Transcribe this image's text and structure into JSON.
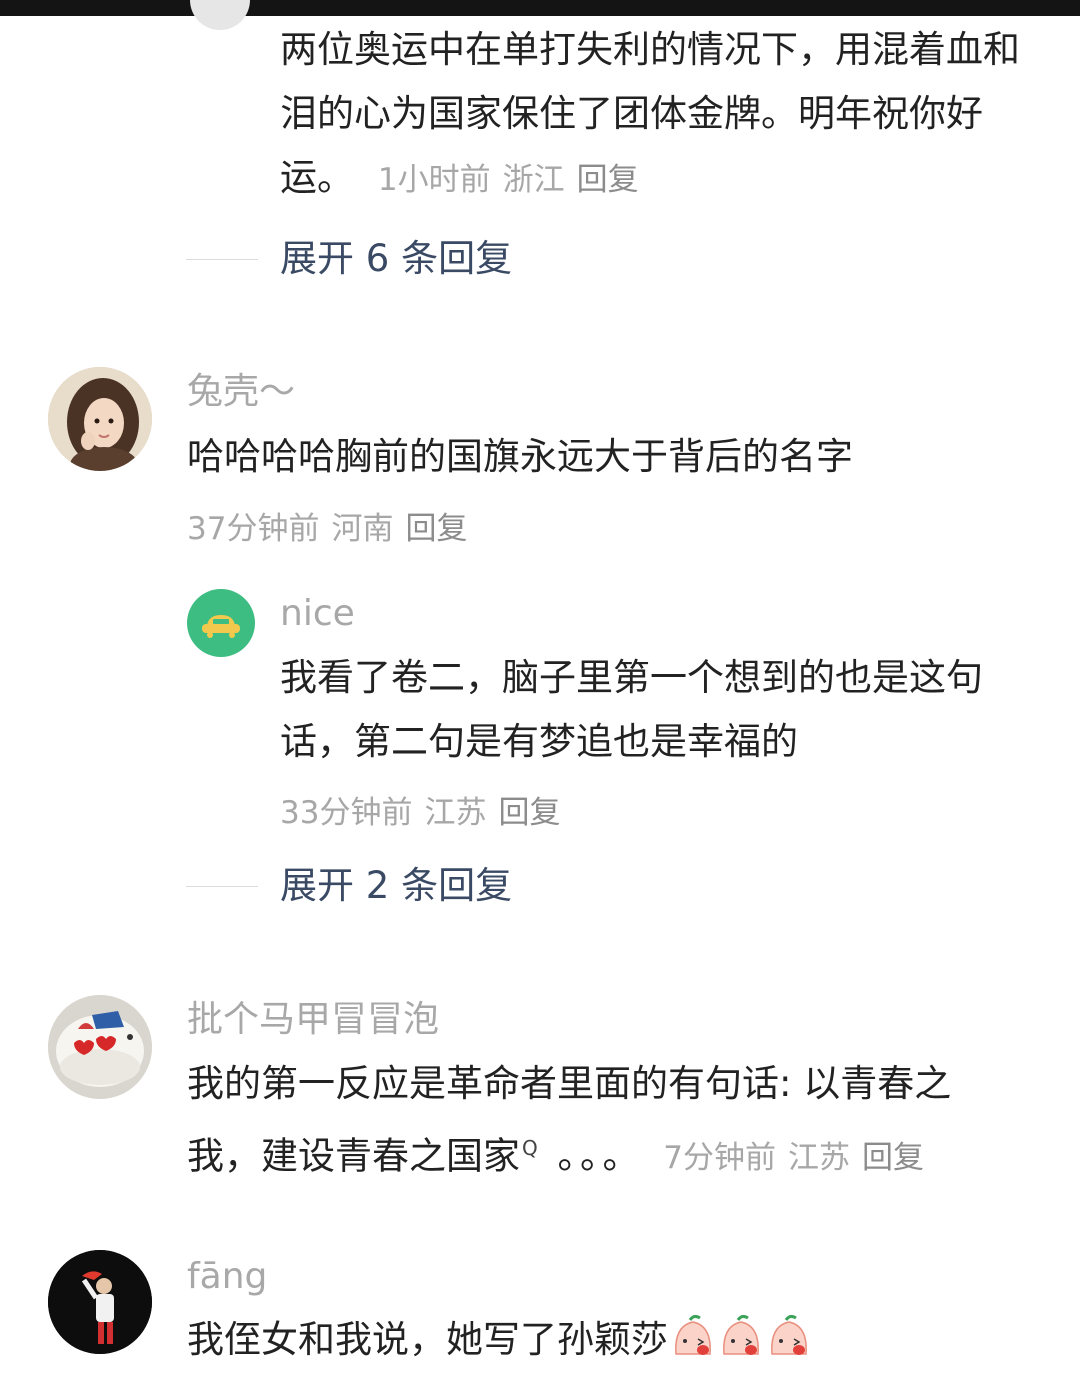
{
  "comments": [
    {
      "text": "两位奥运中在单打失利的情况下，用混着血和泪的心为国家保住了团体金牌。明年祝你好运。",
      "time": "1小时前",
      "location": "浙江",
      "reply_label": "回复",
      "expand_label": "展开 6 条回复"
    },
    {
      "username": "兔壳～",
      "text": "哈哈哈哈胸前的国旗永远大于背后的名字",
      "time": "37分钟前",
      "location": "河南",
      "reply_label": "回复",
      "reply": {
        "username": "nice",
        "text": "我看了卷二，脑子里第一个想到的也是这句话，第二句是有梦追也是幸福的",
        "time": "33分钟前",
        "location": "江苏",
        "reply_label": "回复"
      },
      "expand_label": "展开 2 条回复"
    },
    {
      "username": "批个马甲冒冒泡",
      "text_line1": "我的第一反应是革命者里面的有句话: 以青春之",
      "text_line2": "我，建设青春之国家",
      "search_marker": "Q",
      "ellipsis": "。。。",
      "time": "7分钟前",
      "location": "江苏",
      "reply_label": "回复"
    },
    {
      "username": "fāng",
      "text": "我侄女和我说，她写了孙颖莎"
    }
  ],
  "icons": [
    "avatar-portrait",
    "car-avatar-icon",
    "cake-avatar",
    "athlete-avatar",
    "peach-emoji-icon"
  ],
  "colors": {
    "username": "#a8a8a8",
    "meta": "#a7a7a7",
    "expand": "#3b4a64",
    "car_avatar_bg": "#3dbd82"
  }
}
